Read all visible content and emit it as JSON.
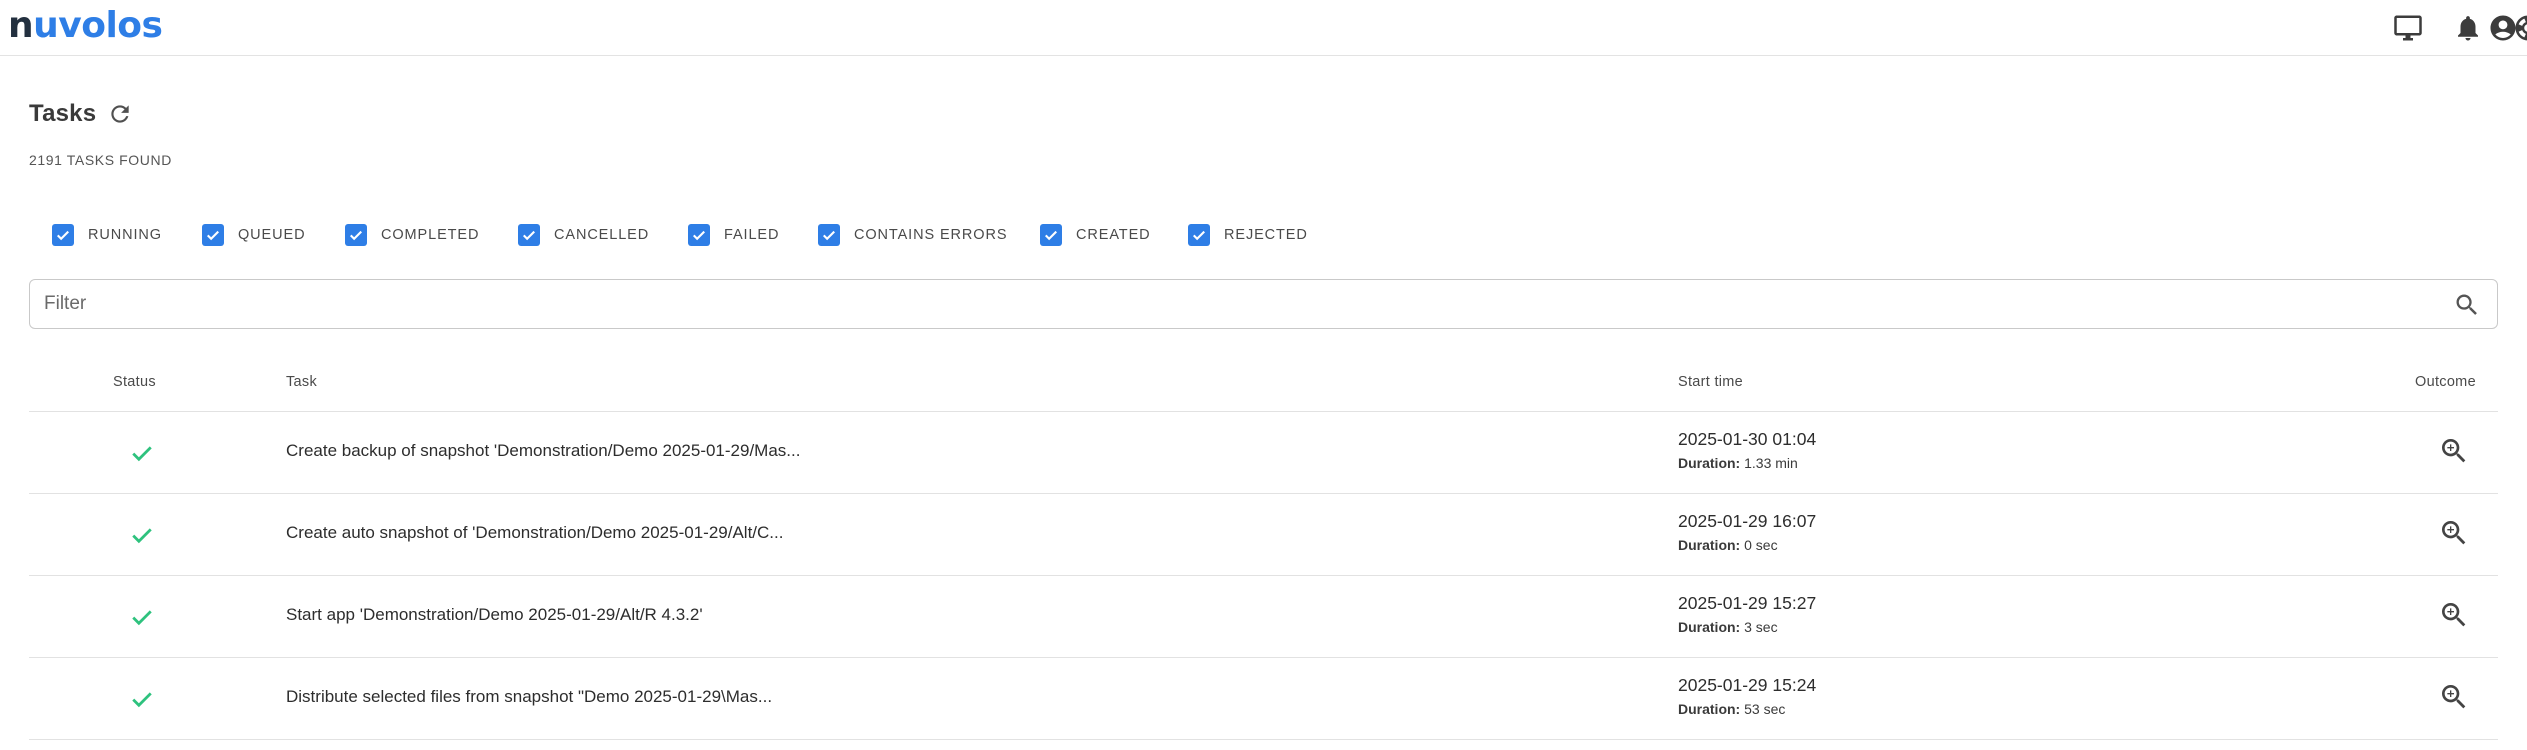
{
  "app": {
    "logo_prefix": "n",
    "logo_rest": "uvolos"
  },
  "topbar": {
    "icons": [
      "monitor-icon",
      "bell-icon",
      "lifebuoy-icon",
      "account-icon"
    ]
  },
  "header": {
    "title": "Tasks",
    "tasks_found": "2191 TASKS FOUND"
  },
  "filters": [
    {
      "label": "RUNNING",
      "checked": true
    },
    {
      "label": "QUEUED",
      "checked": true
    },
    {
      "label": "COMPLETED",
      "checked": true
    },
    {
      "label": "CANCELLED",
      "checked": true
    },
    {
      "label": "FAILED",
      "checked": true
    },
    {
      "label": "CONTAINS ERRORS",
      "checked": true
    },
    {
      "label": "CREATED",
      "checked": true
    },
    {
      "label": "REJECTED",
      "checked": true
    }
  ],
  "search": {
    "placeholder": "Filter",
    "value": ""
  },
  "table": {
    "headers": {
      "status": "Status",
      "task": "Task",
      "start": "Start time",
      "outcome": "Outcome"
    },
    "duration_label": "Duration:",
    "rows": [
      {
        "status": "completed",
        "task": "Create backup of snapshot 'Demonstration/Demo 2025-01-29/Mas...",
        "start": "2025-01-30 01:04",
        "duration": "1.33 min"
      },
      {
        "status": "completed",
        "task": "Create auto snapshot of 'Demonstration/Demo 2025-01-29/Alt/C...",
        "start": "2025-01-29 16:07",
        "duration": "0 sec"
      },
      {
        "status": "completed",
        "task": "Start app 'Demonstration/Demo 2025-01-29/Alt/R 4.3.2'",
        "start": "2025-01-29 15:27",
        "duration": "3 sec"
      },
      {
        "status": "completed",
        "task": "Distribute selected files from snapshot \"Demo 2025-01-29\\Mas...",
        "start": "2025-01-29 15:24",
        "duration": "53 sec"
      }
    ]
  },
  "colors": {
    "accent": "#2e7ee6",
    "success": "#2ec27e",
    "logo_dark": "#23303f"
  }
}
